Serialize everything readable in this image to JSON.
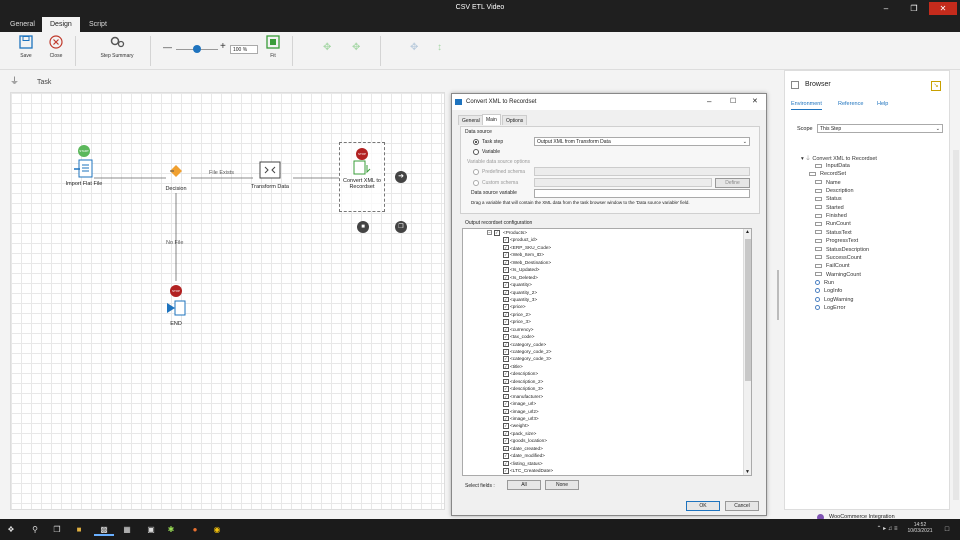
{
  "window": {
    "title": "CSV ETL Video"
  },
  "tabs": [
    "General",
    "Design",
    "Script"
  ],
  "ribbon": {
    "save": "Save",
    "close": "Close",
    "step_summary": "Step Summary",
    "zoom": "100 %",
    "fit": "Fit"
  },
  "task_label": "Task",
  "flow": {
    "nodes": {
      "import": "Import Flat File",
      "decision": "Decision",
      "transform": "Transform Data",
      "convert": "Convert XML to Recordset",
      "end": "END"
    },
    "badges": {
      "start": "START",
      "stop": "STOP"
    },
    "edges": {
      "file_exists": "File Exists",
      "no_file": "No File"
    }
  },
  "dialog": {
    "title": "Convert XML to Recordset",
    "tabs": [
      "General",
      "Main",
      "Options"
    ],
    "data_source": "Data source",
    "task_step": "Task step",
    "task_step_value": "Output XML from Transform Data",
    "variable": "Variable",
    "variable_options": "Variable data source options",
    "predefined_schema": "Predefined schema",
    "custom_schema": "Custom schema",
    "define": "Define",
    "ds_variable": "Data source variable",
    "hint": "Drag a variable that will contain the XML data from the task browser window to the 'Data source variable' field.",
    "output_config": "Output recordset configuration",
    "root": "<Products>",
    "fields": [
      "<product_id>",
      "<ERP_SKU_Code>",
      "<Web_Item_ID>",
      "<Web_Destination>",
      "<Is_Updated>",
      "<Is_Deleted>",
      "<quantity>",
      "<quantity_2>",
      "<quantity_3>",
      "<price>",
      "<price_2>",
      "<price_3>",
      "<currency>",
      "<tax_code>",
      "<category_code>",
      "<category_code_2>",
      "<category_code_3>",
      "<title>",
      "<description>",
      "<description_2>",
      "<description_3>",
      "<manufacturer>",
      "<image_url>",
      "<image_url2>",
      "<image_url3>",
      "<weight>",
      "<pack_size>",
      "<goods_location>",
      "<date_created>",
      "<date_modified>",
      "<listing_status>",
      "<LTC_CreatedDate>"
    ],
    "select_fields": "Select fields :",
    "all": "All",
    "none": "None",
    "ok": "OK",
    "cancel": "Cancel"
  },
  "browser": {
    "title": "Browser",
    "tabs": [
      "Environment",
      "Reference",
      "Help"
    ],
    "scope_label": "Scope",
    "scope_value": "This Step",
    "root": "Convert XML to Recordset",
    "items": [
      "InputData",
      "RecordSet",
      "Name",
      "Description",
      "Status",
      "Started",
      "Finished",
      "RunCount",
      "StatusText",
      "ProgressText",
      "StatusDescription",
      "SuccessCount",
      "FailCount",
      "WarningCount",
      "Run",
      "LogInfo",
      "LogWarning",
      "LogError"
    ],
    "footer": "WooCommerce Integration"
  },
  "taskbar": {
    "time": "14:52",
    "date": "10/03/2021"
  },
  "colors": {
    "accent": "#1e73be",
    "stop": "#b22222",
    "start": "#5cb85c"
  }
}
